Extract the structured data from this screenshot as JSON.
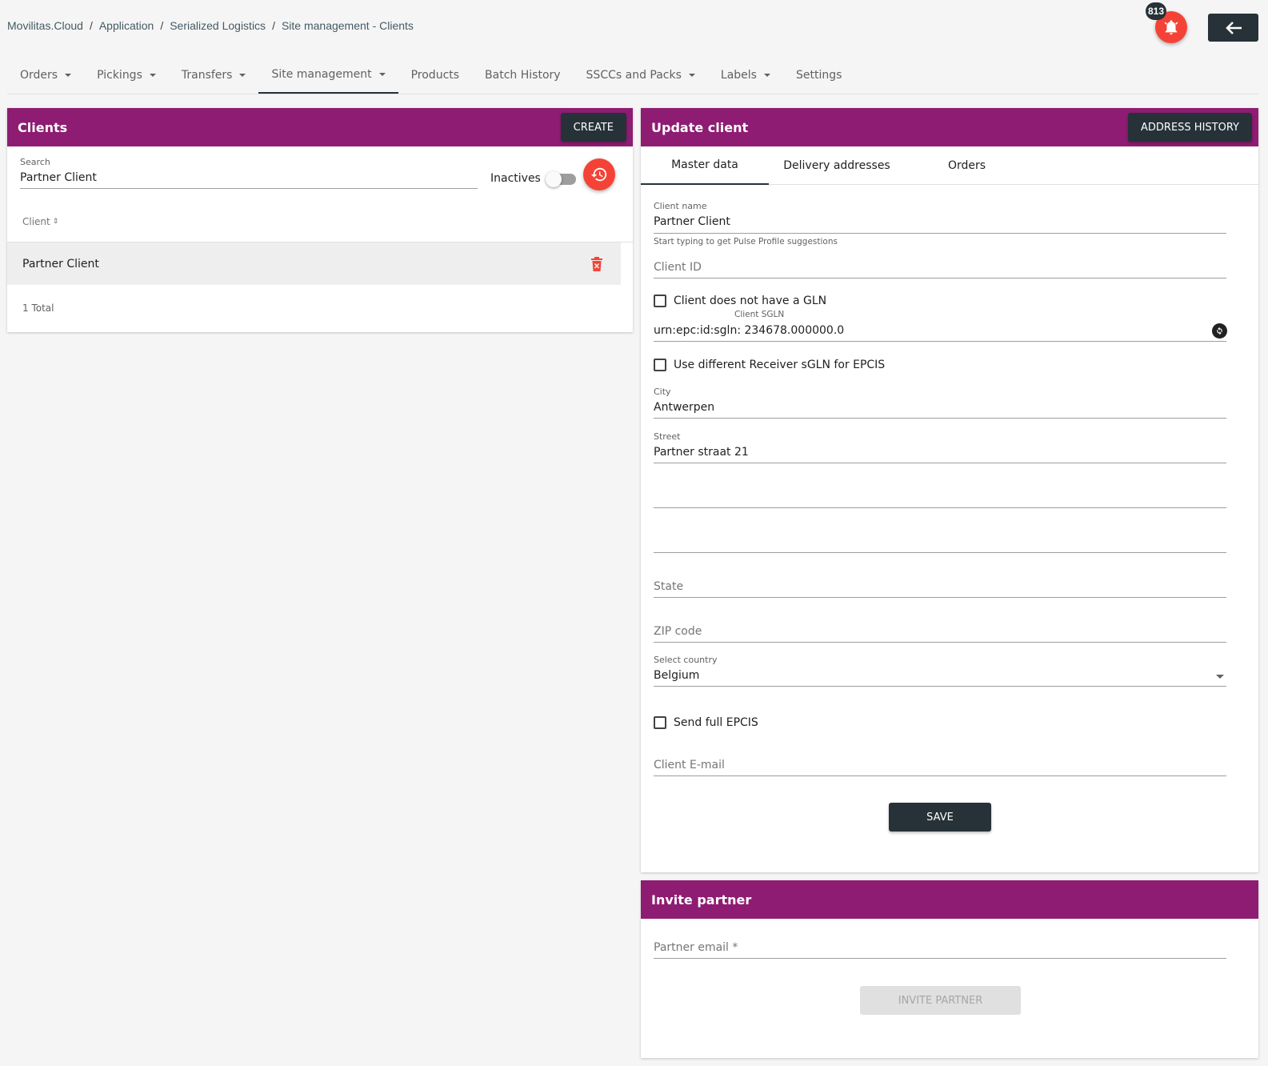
{
  "breadcrumb": [
    "Movilitas.Cloud",
    "Application",
    "Serialized Logistics",
    "Site management - Clients"
  ],
  "notifications": {
    "count": "813",
    "icon": "bell-icon"
  },
  "nav": [
    {
      "label": "Orders",
      "dropdown": true
    },
    {
      "label": "Pickings",
      "dropdown": true
    },
    {
      "label": "Transfers",
      "dropdown": true
    },
    {
      "label": "Site management",
      "dropdown": true,
      "active": true
    },
    {
      "label": "Products",
      "dropdown": false
    },
    {
      "label": "Batch History",
      "dropdown": false
    },
    {
      "label": "SSCCs and Packs",
      "dropdown": true
    },
    {
      "label": "Labels",
      "dropdown": true
    },
    {
      "label": "Settings",
      "dropdown": false
    }
  ],
  "clients": {
    "title": "Clients",
    "create_label": "CREATE",
    "search_label": "Search",
    "search_value": "Partner Client",
    "inactives_label": "Inactives",
    "inactives_on": false,
    "column_header": "Client",
    "rows": [
      {
        "name": "Partner Client"
      }
    ],
    "total": "1 Total"
  },
  "update": {
    "title": "Update client",
    "address_history_label": "ADDRESS HISTORY",
    "tabs": [
      "Master data",
      "Delivery addresses",
      "Orders"
    ],
    "client_name_label": "Client name",
    "client_name_value": "Partner Client",
    "client_name_hint": "Start typing to get Pulse Profile suggestions",
    "client_id_placeholder": "Client ID",
    "no_gln_label": "Client does not have a GLN",
    "sgln_label": "Client SGLN",
    "sgln_value": "urn:epc:id:sgln: 234678.000000.0",
    "receiver_sgln_label": "Use different Receiver sGLN for EPCIS",
    "city_label": "City",
    "city_value": "Antwerpen",
    "street_label": "Street",
    "street_value": "Partner straat 21",
    "state_placeholder": "State",
    "zip_placeholder": "ZIP code",
    "country_label": "Select country",
    "country_value": "Belgium",
    "full_epcis_label": "Send full EPCIS",
    "email_placeholder": "Client E-mail",
    "save_label": "SAVE"
  },
  "invite": {
    "title": "Invite partner",
    "email_placeholder": "Partner email *",
    "button_label": "INVITE PARTNER"
  },
  "colors": {
    "brand": "#8e1c72",
    "dark": "#263238",
    "accent_red": "#f44336"
  }
}
